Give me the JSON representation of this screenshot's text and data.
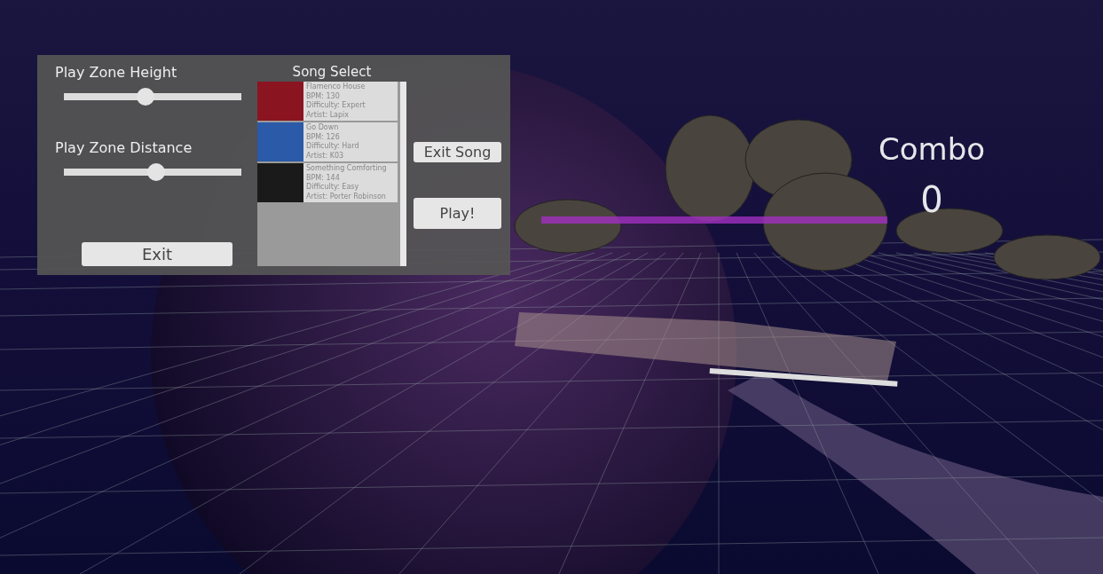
{
  "settings_panel": {
    "sliders": [
      {
        "label": "Play Zone Height",
        "level": 0.46
      },
      {
        "label": "Play Zone Distance",
        "level": 0.52
      }
    ],
    "exit_button": "Exit"
  },
  "song_select": {
    "title": "Song Select",
    "songs": [
      {
        "title": "Flamenco House",
        "bpm": "BPM: 130",
        "difficulty": "Difficulty: Expert",
        "artist": "Artist: Lapix",
        "selected": false
      },
      {
        "title": "Go Down",
        "bpm": "BPM: 126",
        "difficulty": "Difficulty: Hard",
        "artist": "Artist: K03",
        "selected": false
      },
      {
        "title": "Something Comforting",
        "bpm": "BPM: 144",
        "difficulty": "Difficulty: Easy",
        "artist": "Artist: Porter Robinson",
        "selected": false
      }
    ]
  },
  "buttons": [
    "Exit Song",
    "Play!"
  ],
  "hud": {
    "label": "Combo",
    "value": "0"
  }
}
